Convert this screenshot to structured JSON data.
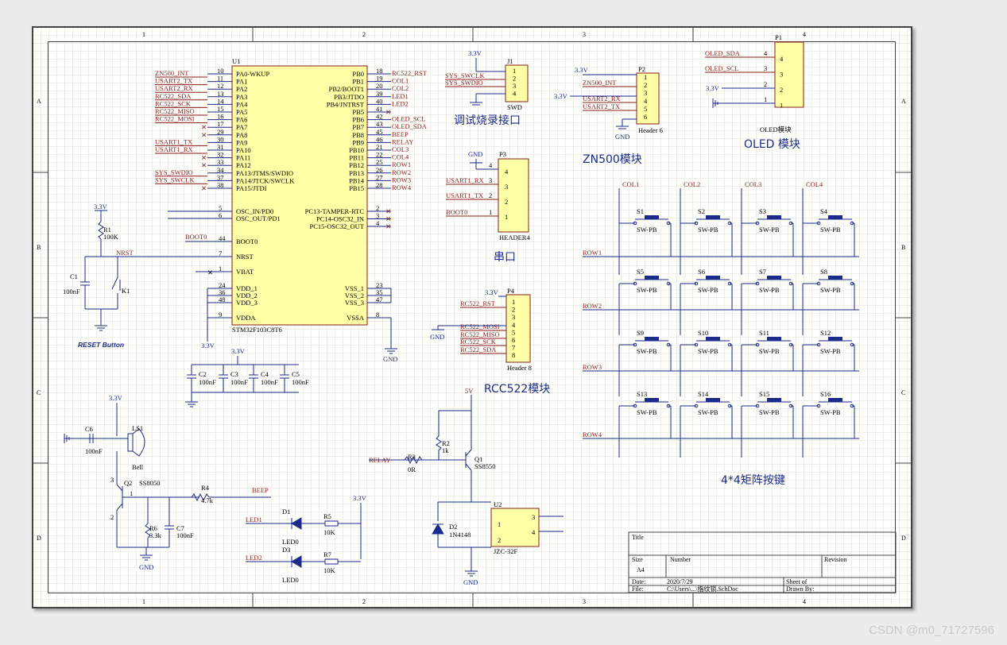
{
  "border": {
    "columns": [
      "1",
      "2",
      "3",
      "4"
    ],
    "rows": [
      "A",
      "B",
      "C",
      "D"
    ]
  },
  "titles": {
    "swd": "调试烧录接口",
    "zn500": "ZN500模块",
    "oled": "OLED 模块",
    "serial": "串口",
    "rc522": "RCC522模块",
    "matrix": "4*4矩阵按键",
    "reset": "RESET Button"
  },
  "u1": {
    "ref": "U1",
    "part": "STM32F103C8T6",
    "left_pins": [
      {
        "num": "10",
        "name": "PA0-WKUP",
        "net": "ZN500_INT"
      },
      {
        "num": "11",
        "name": "PA1",
        "net": "USART2_TX"
      },
      {
        "num": "12",
        "name": "PA2",
        "net": "USART2_RX"
      },
      {
        "num": "13",
        "name": "PA3",
        "net": "RC522_SDA"
      },
      {
        "num": "14",
        "name": "PA4",
        "net": "RC522_SCK"
      },
      {
        "num": "15",
        "name": "PA5",
        "net": "RC522_MISO"
      },
      {
        "num": "16",
        "name": "PA6",
        "net": "RC522_MOSI"
      },
      {
        "num": "17",
        "name": "PA7",
        "net": ""
      },
      {
        "num": "29",
        "name": "PA8",
        "net": ""
      },
      {
        "num": "30",
        "name": "PA9",
        "net": "USART1_TX"
      },
      {
        "num": "31",
        "name": "PA10",
        "net": "USART1_RX"
      },
      {
        "num": "32",
        "name": "PA11",
        "net": ""
      },
      {
        "num": "33",
        "name": "PA12",
        "net": ""
      },
      {
        "num": "34",
        "name": "PA13/JTMS/SWDIO",
        "net": "SYS_SWDIO"
      },
      {
        "num": "37",
        "name": "PA14/JTCK/SWCLK",
        "net": "SYS_SWCLK"
      },
      {
        "num": "38",
        "name": "PA15/JTDI",
        "net": ""
      }
    ],
    "right_pins": [
      {
        "num": "18",
        "name": "PB0",
        "net": "RC522_RST"
      },
      {
        "num": "19",
        "name": "PB1",
        "net": "COL1"
      },
      {
        "num": "20",
        "name": "PB2/BOOT1",
        "net": "COL2"
      },
      {
        "num": "39",
        "name": "PB3/JTDO",
        "net": "LED1"
      },
      {
        "num": "40",
        "name": "PB4/JNTRST",
        "net": "LED2"
      },
      {
        "num": "41",
        "name": "PB5",
        "net": ""
      },
      {
        "num": "42",
        "name": "PB6",
        "net": "OLED_SCL"
      },
      {
        "num": "43",
        "name": "PB7",
        "net": "OLED_SDA"
      },
      {
        "num": "45",
        "name": "PB8",
        "net": "BEEP"
      },
      {
        "num": "46",
        "name": "PB9",
        "net": "RELAY"
      },
      {
        "num": "21",
        "name": "PB10",
        "net": "COL3"
      },
      {
        "num": "22",
        "name": "PB11",
        "net": "COL4"
      },
      {
        "num": "25",
        "name": "PB12",
        "net": "ROW1"
      },
      {
        "num": "26",
        "name": "PB13",
        "net": "ROW2"
      },
      {
        "num": "27",
        "name": "PB14",
        "net": "ROW3"
      },
      {
        "num": "28",
        "name": "PB15",
        "net": "ROW4"
      }
    ],
    "osc_left": [
      {
        "num": "5",
        "name": "OSC_IN/PD0"
      },
      {
        "num": "6",
        "name": "OSC_OUT/PD1"
      }
    ],
    "osc_right": [
      {
        "num": "2",
        "name": "PC13-TAMPER-RTC"
      },
      {
        "num": "3",
        "name": "PC14-OSC32_IN"
      },
      {
        "num": "4",
        "name": "PC15-OSC32_OUT"
      }
    ],
    "boot": {
      "num": "44",
      "name": "BOOT0",
      "net": "BOOT0"
    },
    "nrst": {
      "num": "7",
      "name": "NRST",
      "net": "NRST"
    },
    "vbat": {
      "num": "1",
      "name": "VBAT"
    },
    "vdd": [
      {
        "num": "24",
        "name": "VDD_1"
      },
      {
        "num": "36",
        "name": "VDD_2"
      },
      {
        "num": "48",
        "name": "VDD_3"
      }
    ],
    "vdda": {
      "num": "9",
      "name": "VDDA"
    },
    "vss": [
      {
        "num": "23",
        "name": "VSS_1"
      },
      {
        "num": "35",
        "name": "VSS_2"
      },
      {
        "num": "47",
        "name": "VSS_3"
      }
    ],
    "vssa": {
      "num": "8",
      "name": "VSSA"
    }
  },
  "power": {
    "v33": "3.3V",
    "gnd": "GND",
    "v5": "5V"
  },
  "reset": {
    "r1": "R1",
    "r1v": "100K",
    "c1": "C1",
    "c1v": "100nF",
    "k1": "K1"
  },
  "caps": [
    {
      "ref": "C2",
      "val": "100nF"
    },
    {
      "ref": "C3",
      "val": "100nF"
    },
    {
      "ref": "C4",
      "val": "100nF"
    },
    {
      "ref": "C5",
      "val": "100nF"
    }
  ],
  "buzzer": {
    "c6": "C6",
    "c6v": "100nF",
    "ls1": "LS1",
    "bell": "Bell",
    "q2": "Q2",
    "q2p": "SS8050",
    "r4": "R4",
    "r4v": "4.7k",
    "beep": "BEEP",
    "r6": "R6",
    "r6v": "3.3k",
    "c7": "C7",
    "c7v": "100nF"
  },
  "leds": [
    {
      "net": "LED1",
      "d": "D1",
      "r": "R5",
      "rv": "10K",
      "label": "LED0"
    },
    {
      "net": "LED2",
      "d": "D3",
      "r": "R7",
      "rv": "10K",
      "label": "LED0"
    }
  ],
  "relay": {
    "net": "RELAY",
    "r3": "R3",
    "r3v": "0R",
    "r2": "R2",
    "r2v": "1k",
    "q1": "Q1",
    "q1p": "SS8550",
    "d2": "D2",
    "d2p": "1N4148",
    "u2": "U2",
    "u2p": "JZC-32F",
    "pins": [
      "1",
      "2",
      "3",
      "4"
    ]
  },
  "j1": {
    "ref": "J1",
    "name": "SWD",
    "pins": [
      "1",
      "2",
      "3",
      "4"
    ],
    "nets": [
      "SYS_SWCLK",
      "SYS_SWDIO"
    ]
  },
  "p2": {
    "ref": "P2",
    "name": "Header 6",
    "pins": [
      "1",
      "2",
      "3",
      "4",
      "5",
      "6"
    ],
    "nets": [
      "ZN500_INT",
      "USART2_RX",
      "USART2_TX"
    ]
  },
  "p1": {
    "ref": "P1",
    "name": "OLED模块",
    "pins": [
      "4",
      "3",
      "2",
      "1"
    ],
    "nets": [
      "OLED_SDA",
      "OLED_SCL"
    ]
  },
  "p3": {
    "ref": "P3",
    "name": "HEADER4",
    "pins": [
      "4",
      "3",
      "2",
      "1"
    ],
    "nets": [
      "USART1_RX",
      "USART1_TX",
      "BOOT0"
    ]
  },
  "p4": {
    "ref": "P4",
    "name": "Header 8",
    "pins": [
      "1",
      "2",
      "3",
      "4",
      "5",
      "6",
      "7",
      "8"
    ],
    "nets": [
      "RC522_RST",
      "RC522_MOSI",
      "RC522_MISO",
      "RC522_SCK",
      "RC522_SDA"
    ]
  },
  "matrix": {
    "cols": [
      "COL1",
      "COL2",
      "COL3",
      "COL4"
    ],
    "rows": [
      "ROW1",
      "ROW2",
      "ROW3",
      "ROW4"
    ],
    "switches": [
      "S1",
      "S2",
      "S3",
      "S4",
      "S5",
      "S6",
      "S7",
      "S8",
      "S9",
      "S10",
      "S11",
      "S12",
      "S13",
      "S14",
      "S15",
      "S16"
    ],
    "part": "SW-PB"
  },
  "titleblock": {
    "title": "Title",
    "size_label": "Size",
    "size": "A4",
    "number_label": "Number",
    "revision_label": "Revision",
    "date_label": "Date:",
    "date": "2020/7/29",
    "sheet": "Sheet    of",
    "file_label": "File:",
    "file": "C:\\Users\\...\\指纹锁.SchDoc",
    "drawn": "Drawn By:"
  },
  "watermark": "CSDN @m0_71727596"
}
